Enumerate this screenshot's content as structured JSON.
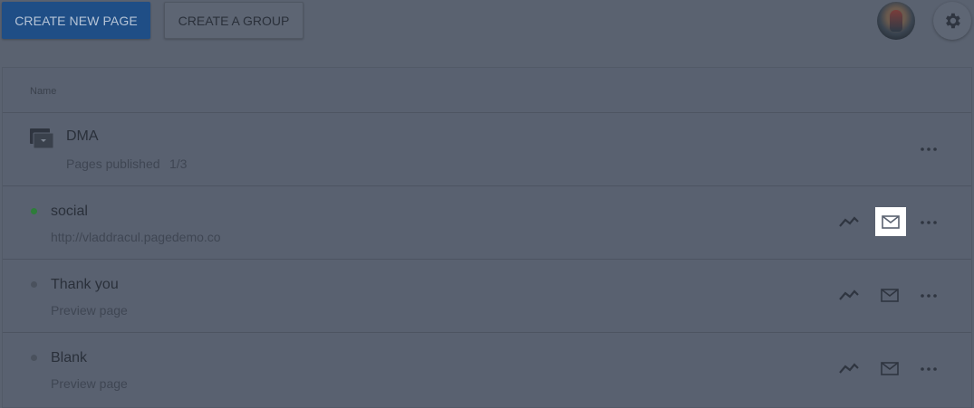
{
  "toolbar": {
    "create_page_label": "CREATE NEW PAGE",
    "create_group_label": "CREATE A GROUP"
  },
  "table": {
    "header_name": "Name",
    "group": {
      "title": "DMA",
      "published_label": "Pages published",
      "published_count": "1/3"
    },
    "rows": [
      {
        "title": "social",
        "subtitle": "http://vladdracul.pagedemo.co",
        "status": "published",
        "status_color": "#2e7d3a"
      },
      {
        "title": "Thank you",
        "subtitle": "Preview page",
        "status": "draft",
        "status_color": "#4a515d"
      },
      {
        "title": "Blank",
        "subtitle": "Preview page",
        "status": "draft",
        "status_color": "#4a515d"
      }
    ]
  },
  "colors": {
    "overlay_bg": "#5a6270",
    "primary_button": "#1f4e86",
    "highlight": "#ffffff"
  },
  "icons": {
    "settings": "gear-icon",
    "folder": "folder-icon",
    "analytics": "trend-line-icon",
    "mail": "mail-icon",
    "more": "more-dots-icon"
  }
}
